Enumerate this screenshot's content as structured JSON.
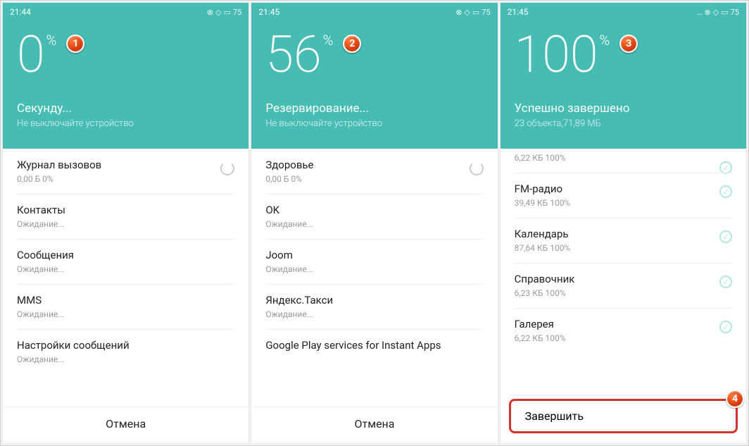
{
  "screens": [
    {
      "time": "21:44",
      "battery": "75",
      "percent": "0",
      "badge": "1",
      "title": "Секунду...",
      "subtitle": "Не выключайте устройство",
      "items": [
        {
          "title": "Журнал вызовов",
          "sub": "0,00 Б 0%",
          "spinner": true
        },
        {
          "title": "Контакты",
          "sub": "Ожидание..."
        },
        {
          "title": "Сообщения",
          "sub": "Ожидание..."
        },
        {
          "title": "MMS",
          "sub": "Ожидание..."
        },
        {
          "title": "Настройки сообщений",
          "sub": "Ожидание..."
        }
      ],
      "footer": "Отмена"
    },
    {
      "time": "21:45",
      "battery": "75",
      "percent": "56",
      "badge": "2",
      "title": "Резервирование...",
      "subtitle": "Не выключайте устройство",
      "items": [
        {
          "title": "Здоровье",
          "sub": "0,00 Б 0%",
          "spinner": true
        },
        {
          "title": "OK",
          "sub": "Ожидание..."
        },
        {
          "title": "Joom",
          "sub": "Ожидание..."
        },
        {
          "title": "Яндекс.Такси",
          "sub": "Ожидание..."
        },
        {
          "title": "Google Play services for Instant Apps",
          "sub": ""
        }
      ],
      "footer": "Отмена"
    },
    {
      "time": "21:45",
      "battery": "75",
      "percent": "100",
      "badge": "3",
      "title": "Успешно завершено",
      "subtitle": "23 объекта,71,89 МБ",
      "toprow": {
        "sub": "6,22 КБ 100%"
      },
      "items": [
        {
          "title": "FM-радио",
          "sub": "39,49 КБ 100%",
          "check": true
        },
        {
          "title": "Календарь",
          "sub": "87,64 КБ 100%",
          "check": true
        },
        {
          "title": "Справочник",
          "sub": "6,23 КБ 100%",
          "check": true
        },
        {
          "title": "Галерея",
          "sub": "6,22 КБ 100%",
          "check": true
        }
      ],
      "footer": "Завершить",
      "footer_badge": "4",
      "footer_highlight": true
    }
  ]
}
